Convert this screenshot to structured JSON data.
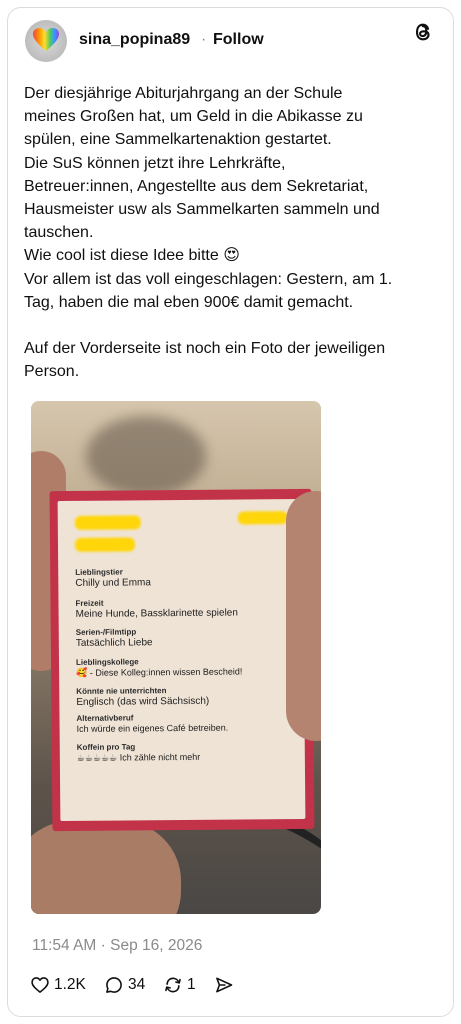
{
  "post": {
    "username": "sina_popina89",
    "separator": "·",
    "follow_label": "Follow",
    "text_lines": [
      "Der diesjährige Abiturjahrgang an der Schule",
      "meines Großen hat, um Geld in die Abikasse zu",
      "spülen, eine Sammelkartenaktion gestartet.",
      "Die SuS können jetzt ihre Lehrkräfte,",
      "Betreuer:innen, Angestellte aus dem Sekretariat,",
      "Hausmeister usw als Sammelkarten sammeln und",
      "tauschen.",
      "Wie cool ist diese Idee bitte 😍",
      "Vor allem ist das voll eingeschlagen: Gestern, am 1.",
      "Tag, haben die mal eben 900€ damit gemacht.",
      "",
      "Auf der Vorderseite ist noch ein Foto der jeweiligen",
      "Person."
    ],
    "timestamp": "11:54 AM · Sep 16, 2026",
    "likes": "1.2K",
    "replies": "34",
    "reposts": "1"
  },
  "trading_card": {
    "fields": [
      {
        "label": "Lieblingstier",
        "value": "Chilly und Emma"
      },
      {
        "label": "Freizeit",
        "value": "Meine Hunde, Bassklarinette spielen"
      },
      {
        "label": "Serien-/Filmtipp",
        "value": "Tatsächlich Liebe"
      },
      {
        "label": "Lieblingskollege",
        "value": "🥰 - Diese Kolleg:innen wissen Bescheid!"
      },
      {
        "label": "Könnte nie unterrichten",
        "value": "Englisch (das wird Sächsisch)"
      },
      {
        "label": "Alternativberuf",
        "value": "Ich würde ein eigenes Café betreiben."
      },
      {
        "label": "Koffein pro Tag",
        "value": "☕☕☕☕☕ Ich zähle nicht mehr"
      }
    ]
  },
  "colors": {
    "card_red": "#c2334a",
    "card_cream": "#efe3d6",
    "censor_yellow": "#ffd60a",
    "muted_text": "#8a8a8a"
  },
  "icons": [
    "threads-logo-icon",
    "heart-icon",
    "reply-bubble-icon",
    "repost-icon",
    "share-send-icon"
  ]
}
